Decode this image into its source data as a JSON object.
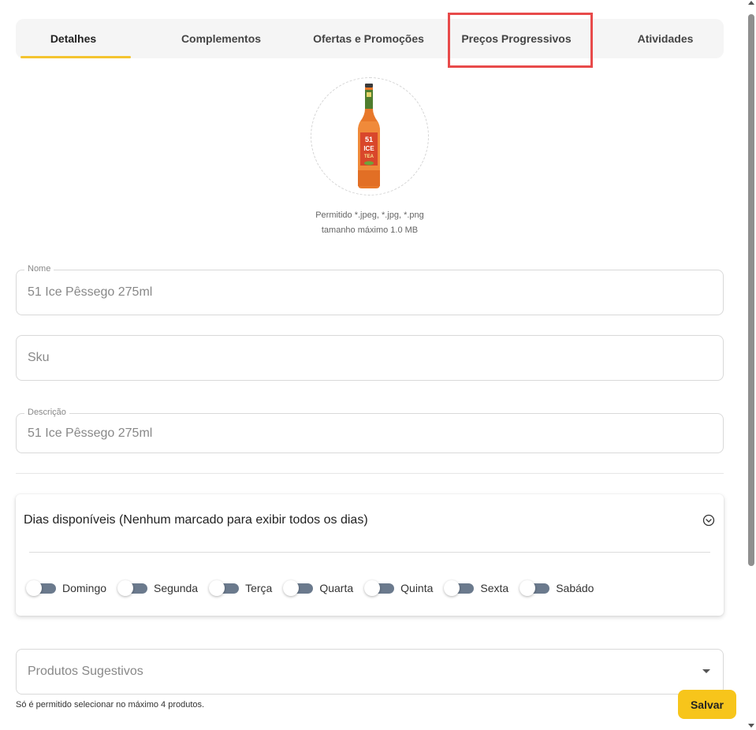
{
  "tabs": [
    {
      "label": "Detalhes",
      "active": true
    },
    {
      "label": "Complementos"
    },
    {
      "label": "Ofertas e Promoções"
    },
    {
      "label": "Preços Progressivos",
      "highlighted": true
    },
    {
      "label": "Atividades"
    }
  ],
  "colors": {
    "accent": "#f4c430",
    "highlight": "#e84a4a",
    "save": "#f7c51b"
  },
  "product_image": {
    "allowed_text": "Permitido *.jpeg, *.jpg, *.png",
    "max_size_text": "tamanho máximo 1.0 MB",
    "bottle_label": [
      "51",
      "ICE",
      "TEA"
    ]
  },
  "fields": {
    "nome": {
      "label": "Nome",
      "value": "51 Ice Pêssego 275ml"
    },
    "sku": {
      "placeholder": "Sku",
      "value": ""
    },
    "descricao": {
      "label": "Descrição",
      "value": "51 Ice Pêssego 275ml"
    }
  },
  "days": {
    "title": "Dias disponíveis (Nenhum marcado para exibir todos os dias)",
    "icon": "chevron-down-circle-icon",
    "items": [
      {
        "label": "Domingo",
        "checked": false
      },
      {
        "label": "Segunda",
        "checked": false
      },
      {
        "label": "Terça",
        "checked": false
      },
      {
        "label": "Quarta",
        "checked": false
      },
      {
        "label": "Quinta",
        "checked": false
      },
      {
        "label": "Sexta",
        "checked": false
      },
      {
        "label": "Sabádo",
        "checked": false
      }
    ]
  },
  "products": {
    "placeholder": "Produtos Sugestivos",
    "help": "Só é permitido selecionar no máximo 4 produtos."
  },
  "actions": {
    "save_label": "Salvar"
  }
}
